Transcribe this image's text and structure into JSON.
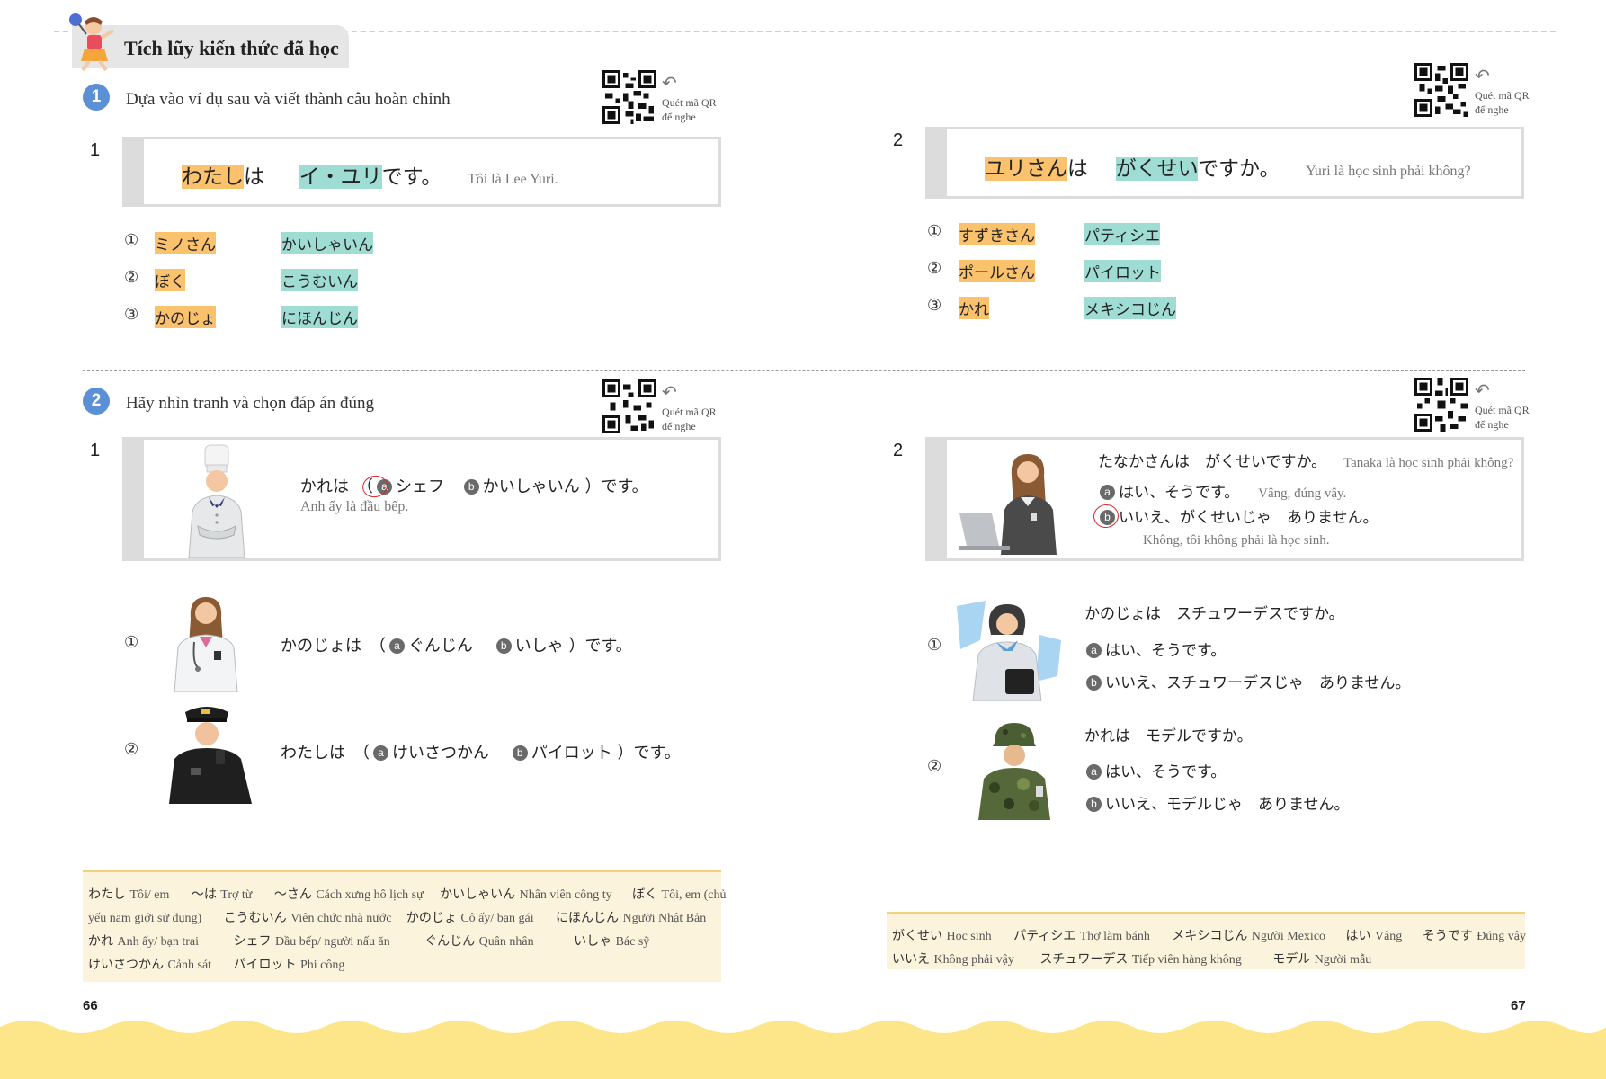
{
  "header": {
    "title": "Tích lũy kiến thức đã học"
  },
  "qr_label_1": "Quét mã QR",
  "qr_label_2": "để nghe",
  "section1": {
    "badge": "1",
    "instruction": "Dựa vào ví dụ sau và viết thành câu hoàn chỉnh",
    "left": {
      "number": "1",
      "example": {
        "subject": "わたし",
        "particle": "は",
        "noun": "イ・ユリ",
        "ending": "です。",
        "translation": "Tôi là Lee Yuri."
      },
      "items": [
        {
          "mark": "①",
          "a": "ミノさん",
          "b": "かいしゃいん"
        },
        {
          "mark": "②",
          "a": "ぼく",
          "b": "こうむいん"
        },
        {
          "mark": "③",
          "a": "かのじょ",
          "b": "にほんじん"
        }
      ]
    },
    "right": {
      "number": "2",
      "example": {
        "subject": "ユリさん",
        "particle": "は",
        "noun": "がくせい",
        "ending": "ですか。",
        "translation": "Yuri là học sinh phải không?"
      },
      "items": [
        {
          "mark": "①",
          "a": "すずきさん",
          "b": "パティシエ"
        },
        {
          "mark": "②",
          "a": "ポールさん",
          "b": "パイロット"
        },
        {
          "mark": "③",
          "a": "かれ",
          "b": "メキシコじん"
        }
      ]
    }
  },
  "section2": {
    "badge": "2",
    "instruction": "Hãy nhìn tranh và chọn đáp án đúng",
    "left": {
      "number": "1",
      "example": {
        "pre": "かれは　（",
        "a_mark": "a",
        "a_text": "シェフ",
        "b_mark": "b",
        "b_text": "かいしゃいん",
        "post": "）です。",
        "translation": "Anh ấy là đầu bếp."
      },
      "items": [
        {
          "mark": "①",
          "pre": "かのじょは　（",
          "a_mark": "a",
          "a_text": "ぐんじん",
          "b_mark": "b",
          "b_text": "いしゃ",
          "post": "）です。"
        },
        {
          "mark": "②",
          "pre": "わたしは　（",
          "a_mark": "a",
          "a_text": "けいさつかん",
          "b_mark": "b",
          "b_text": "パイロット",
          "post": "）です。"
        }
      ]
    },
    "right": {
      "number": "2",
      "example": {
        "question": "たなかさんは　がくせいですか。",
        "question_vn": "Tanaka là học sinh phải không?",
        "a_mark": "a",
        "a_text": "はい、そうです。",
        "a_vn": "Vâng, đúng vậy.",
        "b_mark": "b",
        "b_text": "いいえ、がくせいじゃ　ありません。",
        "b_vn": "Không, tôi không phải là học sinh."
      },
      "items": [
        {
          "mark": "①",
          "question": "かのじょは　スチュワーデスですか。",
          "a_mark": "a",
          "a_text": "はい、そうです。",
          "b_mark": "b",
          "b_text": "いいえ、スチュワーデスじゃ　ありません。"
        },
        {
          "mark": "②",
          "question": "かれは　モデルですか。",
          "a_mark": "a",
          "a_text": "はい、そうです。",
          "b_mark": "b",
          "b_text": "いいえ、モデルじゃ　ありません。"
        }
      ]
    }
  },
  "vocab_left": [
    [
      {
        "jp": "わたし",
        "vn": "Tôi/ em"
      },
      {
        "jp": "〜は",
        "vn": "Trợ từ"
      },
      {
        "jp": "〜さん",
        "vn": "Cách xưng hô lịch sự"
      },
      {
        "jp": "かいしゃいん",
        "vn": "Nhân viên công ty"
      },
      {
        "jp": "ぼく",
        "vn": "Tôi, em (chủ"
      }
    ],
    [
      {
        "jp": "",
        "vn": "yếu nam giới sử dụng)"
      },
      {
        "jp": "こうむいん",
        "vn": "Viên chức nhà nước"
      },
      {
        "jp": "かのじょ",
        "vn": "Cô ấy/ bạn gái"
      },
      {
        "jp": "にほんじん",
        "vn": "Người Nhật Bản"
      }
    ],
    [
      {
        "jp": "かれ",
        "vn": "Anh ấy/ bạn trai"
      },
      {
        "jp": "シェフ",
        "vn": "Đầu bếp/ người nấu ăn"
      },
      {
        "jp": "ぐんじん",
        "vn": "Quân nhân"
      },
      {
        "jp": "いしゃ",
        "vn": "Bác sỹ"
      }
    ],
    [
      {
        "jp": "けいさつかん",
        "vn": "Cảnh sát"
      },
      {
        "jp": "パイロット",
        "vn": "Phi công"
      }
    ]
  ],
  "vocab_right": [
    [
      {
        "jp": "がくせい",
        "vn": "Học sinh"
      },
      {
        "jp": "パティシエ",
        "vn": "Thợ làm bánh"
      },
      {
        "jp": "メキシコじん",
        "vn": "Người Mexico"
      },
      {
        "jp": "はい",
        "vn": "Vâng"
      },
      {
        "jp": "そうです",
        "vn": "Đúng vậy"
      }
    ],
    [
      {
        "jp": "いいえ",
        "vn": "Không phải vậy"
      },
      {
        "jp": "スチュワーデス",
        "vn": "Tiếp viên hàng không"
      },
      {
        "jp": "モデル",
        "vn": "Người mẫu"
      }
    ]
  ],
  "pages": {
    "left": "66",
    "right": "67"
  },
  "colors": {
    "orange_highlight": "#fbc26e",
    "teal_highlight": "#9fdcd3",
    "badge_blue": "#5b8fd6",
    "answer_ring": "#d8272a",
    "wave_yellow": "#fde68a",
    "vocab_bg": "#fcf3dc"
  },
  "icons": [
    "qr-code-icon",
    "back-arrow-icon",
    "mascot-girl-icon"
  ]
}
